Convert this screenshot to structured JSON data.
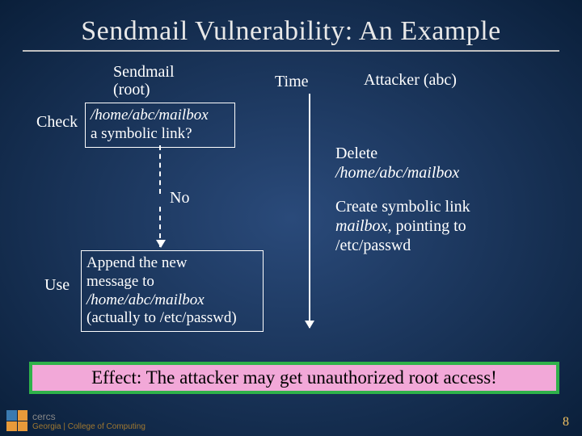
{
  "title": "Sendmail Vulnerability: An Example",
  "left_header_1": "Sendmail",
  "left_header_2": "(root)",
  "time_label": "Time",
  "attacker_label": "Attacker (abc)",
  "check": {
    "label": "Check",
    "path": "/home/abc/mailbox",
    "question": "a symbolic link?"
  },
  "no_label": "No",
  "use": {
    "label": "Use",
    "line1": "Append the new",
    "line2": "message to",
    "path": "/home/abc/mailbox",
    "line4": "(actually to /etc/passwd)"
  },
  "attacker_delete": {
    "label": "Delete",
    "path": "/home/abc/mailbox"
  },
  "attacker_create": {
    "line1": "Create symbolic link",
    "path": "mailbox",
    "line2_rest": ", pointing to",
    "line3": "/etc/passwd"
  },
  "effect": "Effect: The attacker may get unauthorized root access!",
  "slide_number": "8",
  "logo_text": "cercs",
  "logo_gt": "Georgia | College of Computing"
}
